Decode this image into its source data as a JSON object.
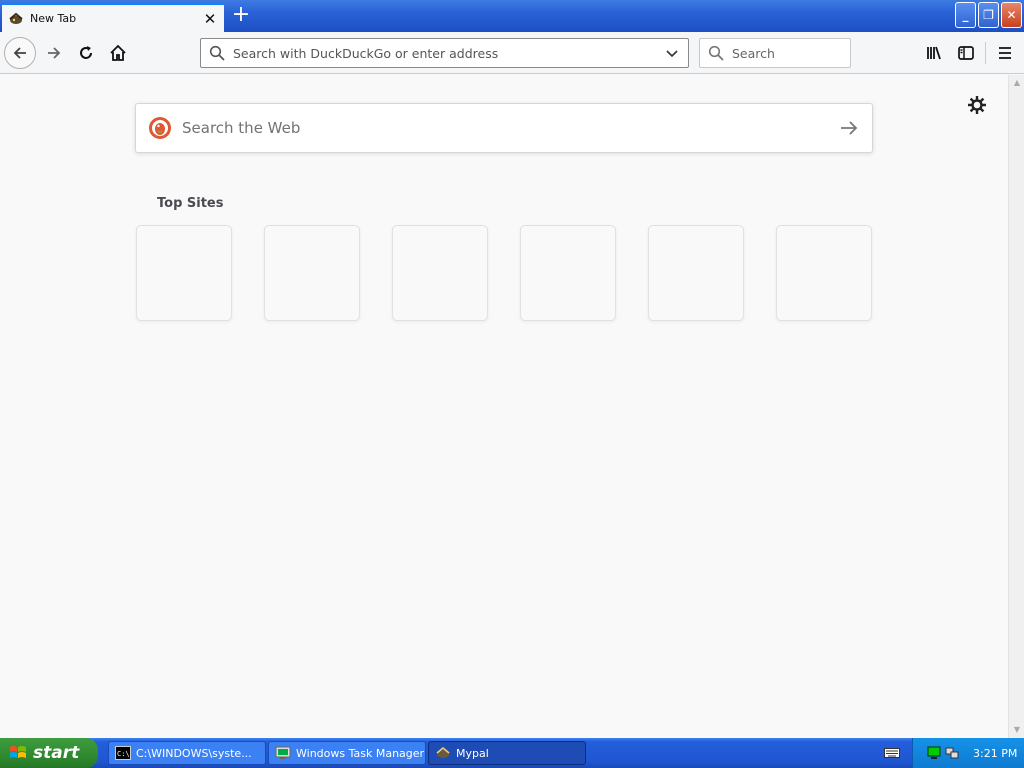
{
  "tab": {
    "title": "New Tab",
    "close": "✕",
    "new_tab": "+"
  },
  "window_controls": {
    "minimize": "_",
    "restore": "❐",
    "close": "✕"
  },
  "urlbar": {
    "value": "",
    "placeholder": "Search with DuckDuckGo or enter address"
  },
  "searchbar": {
    "placeholder": "Search"
  },
  "newtab": {
    "web_search_placeholder": "Search the Web",
    "top_sites_title": "Top Sites",
    "top_sites": [
      "",
      "",
      "",
      "",
      "",
      ""
    ]
  },
  "taskbar": {
    "start_label": "start",
    "tasks": [
      {
        "label": "C:\\WINDOWS\\syste...",
        "icon": "console-icon"
      },
      {
        "label": "Windows Task Manager",
        "icon": "task-manager-icon"
      },
      {
        "label": "Mypal",
        "icon": "mypal-icon"
      }
    ],
    "clock": "3:21 PM"
  },
  "colors": {
    "accent": "#0a84ff",
    "taskbar": "#245edb",
    "start": "#2f8a2f",
    "ddg": "#de5833"
  }
}
